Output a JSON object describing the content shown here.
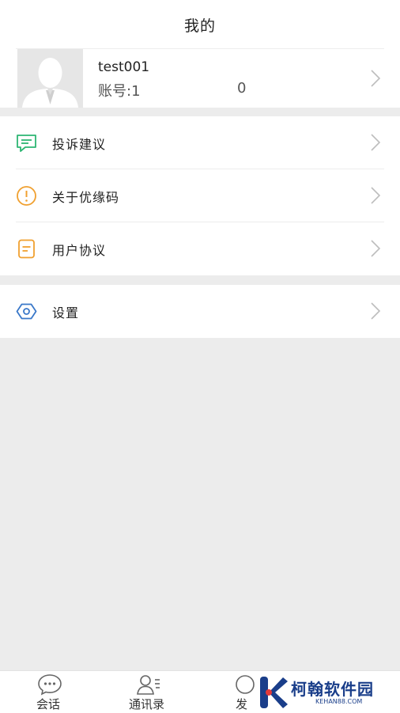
{
  "header": {
    "title": "我的"
  },
  "profile": {
    "name": "test001",
    "account_prefix": "账号:1",
    "account_suffix": "0"
  },
  "menu_group_1": [
    {
      "label": "投诉建议",
      "icon": "message-icon",
      "color": "#2db673"
    },
    {
      "label": "关于优缘码",
      "icon": "info-icon",
      "color": "#f0a030"
    },
    {
      "label": "用户协议",
      "icon": "document-icon",
      "color": "#f0a030"
    }
  ],
  "menu_group_2": [
    {
      "label": "设置",
      "icon": "settings-hex-icon",
      "color": "#3a78c9"
    }
  ],
  "tabbar": {
    "tabs": [
      {
        "label": "会话",
        "icon": "chat-bubble-icon"
      },
      {
        "label": "通讯录",
        "icon": "contacts-icon"
      },
      {
        "label": "发",
        "icon": "discover-icon"
      }
    ]
  },
  "watermark": {
    "text": "柯翰软件园",
    "url": "KEHAN88.COM"
  }
}
